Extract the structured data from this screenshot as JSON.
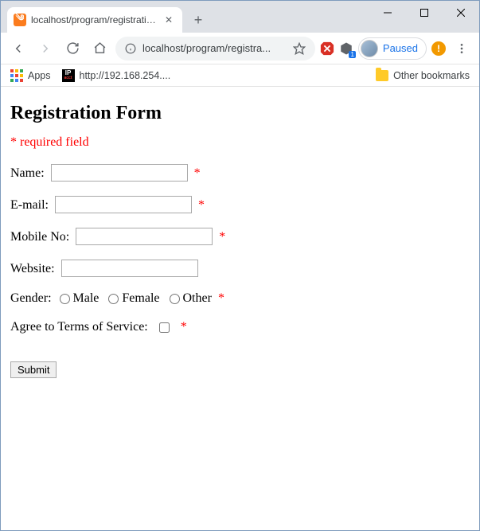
{
  "browser": {
    "tab_title": "localhost/program/registration.p",
    "url_display": "localhost/program/registra...",
    "paused_label": "Paused",
    "bookmarks": {
      "apps_label": "Apps",
      "ip_label": "http://192.168.254....",
      "other_label": "Other bookmarks"
    }
  },
  "form": {
    "heading": "Registration Form",
    "required_note": "* required field",
    "name_label": "Name:",
    "email_label": "E-mail:",
    "mobile_label": "Mobile No:",
    "website_label": "Website:",
    "gender_label": "Gender:",
    "gender_options": {
      "male": "Male",
      "female": "Female",
      "other": "Other"
    },
    "terms_label": "Agree to Terms of Service:",
    "submit_label": "Submit",
    "star": "*"
  }
}
